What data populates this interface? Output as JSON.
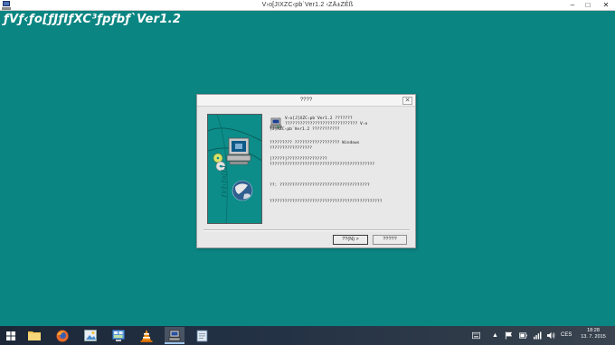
{
  "window": {
    "title": "V›o[JIXZC‹pb`Ver1.2 ‹ZÄ±ZÉß",
    "minimize": "–",
    "maximize": "□",
    "close": "✕"
  },
  "banner": {
    "title": "ƒVƒ‹ƒo[ƒJƒIƒXC³ƒpƒbƒ`Ver1.2"
  },
  "dialog": {
    "title": "????",
    "close": "✕",
    "side_label": "ƒVƒ‹ƒo[ƒJ",
    "messages": {
      "line1a": "V›o[J]XZC‹pb`Ver1.2 ???????",
      "line1b": "????????????????????????????? V›o",
      "line1c": "[J]XZC‹pb`Ver1.2 ???????????",
      "line2a": "????????? ?????????????????? Windows",
      "line2b": "?????????????????",
      "line3a": "[?????]????????????????",
      "line3b": "??????????????????????????????????????????",
      "line4": "??: ????????????????????????????????????",
      "line5": "?????????????????????????????????????????????"
    },
    "next_button": "??(N) >",
    "cancel_button": "?????"
  },
  "taskbar": {
    "apps": [
      {
        "name": "file-explorer"
      },
      {
        "name": "firefox"
      },
      {
        "name": "image-viewer"
      },
      {
        "name": "control-panel"
      },
      {
        "name": "vlc"
      },
      {
        "name": "setup-program"
      },
      {
        "name": "notepad"
      }
    ],
    "language": "CES",
    "time": "18:28",
    "date": "13. 7. 2015"
  },
  "colors": {
    "desktop": "#0b8582",
    "side_panel": "#0c8d89"
  }
}
